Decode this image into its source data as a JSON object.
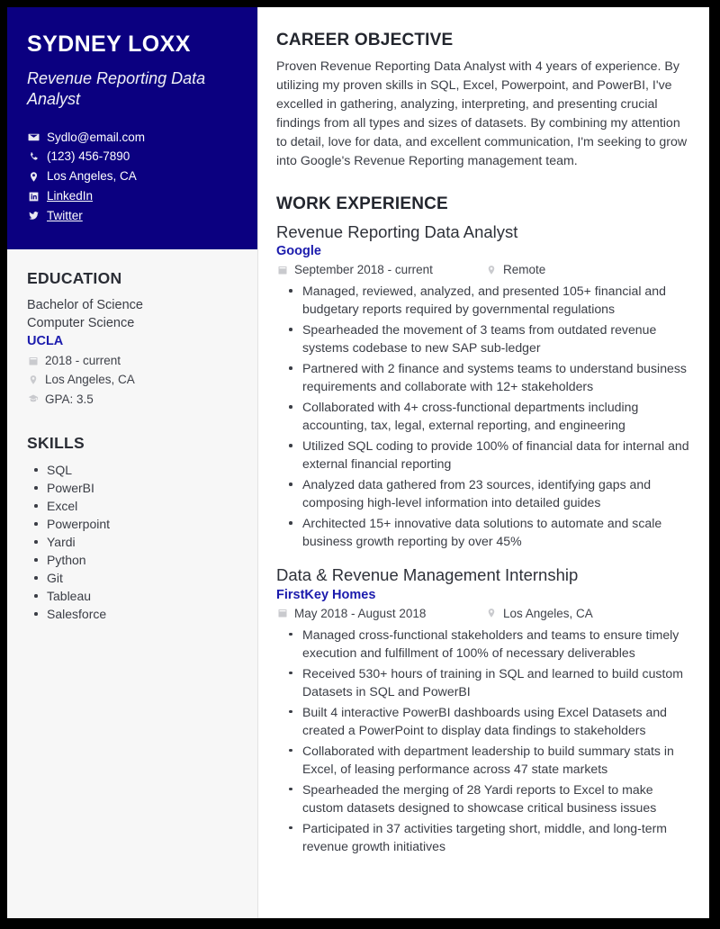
{
  "colors": {
    "sidebar_header_bg": "#0b0080",
    "accent_link": "#1b1bad",
    "sidebar_bg": "#f7f7f7",
    "page_border": "#000000",
    "body_text": "#3a3d45"
  },
  "sidebar": {
    "name": "SYDNEY LOXX",
    "title": "Revenue Reporting Data Analyst",
    "contacts": [
      {
        "icon": "envelope-icon",
        "text": "Sydlo@email.com",
        "is_link": false
      },
      {
        "icon": "phone-icon",
        "text": "(123) 456-7890",
        "is_link": false
      },
      {
        "icon": "location-pin-icon",
        "text": "Los Angeles, CA",
        "is_link": false
      },
      {
        "icon": "linkedin-icon",
        "text": "LinkedIn",
        "is_link": true
      },
      {
        "icon": "twitter-icon",
        "text": "Twitter",
        "is_link": true
      }
    ],
    "education": {
      "heading": "EDUCATION",
      "degree_line1": "Bachelor of Science",
      "degree_line2": "Computer Science",
      "school": "UCLA",
      "meta": [
        {
          "icon": "calendar-icon",
          "text": "2018 - current"
        },
        {
          "icon": "location-pin-icon",
          "text": "Los Angeles, CA"
        },
        {
          "icon": "graduation-cap-icon",
          "text": "GPA: 3.5"
        }
      ]
    },
    "skills": {
      "heading": "SKILLS",
      "items": [
        "SQL",
        "PowerBI",
        "Excel",
        "Powerpoint",
        "Yardi",
        "Python",
        "Git",
        "Tableau",
        "Salesforce"
      ]
    }
  },
  "main": {
    "objective": {
      "heading": "CAREER OBJECTIVE",
      "text": "Proven Revenue Reporting Data Analyst with 4 years of experience. By utilizing my proven skills in SQL, Excel, Powerpoint, and PowerBI, I've excelled in gathering, analyzing, interpreting, and presenting crucial findings from all types and sizes of datasets. By combining my attention to detail, love for data, and excellent communication, I'm seeking to grow into Google's Revenue Reporting management team."
    },
    "work": {
      "heading": "WORK EXPERIENCE",
      "jobs": [
        {
          "role": "Revenue Reporting Data Analyst",
          "company": "Google",
          "dates": "September 2018 - current",
          "location": "Remote",
          "bullets": [
            "Managed, reviewed, analyzed, and presented 105+ financial and budgetary reports required by governmental regulations",
            "Spearheaded the movement of 3 teams from outdated revenue systems codebase to new SAP sub-ledger",
            "Partnered with 2 finance and systems teams to understand business requirements and collaborate with 12+ stakeholders",
            "Collaborated with 4+ cross-functional departments including accounting, tax, legal, external reporting, and engineering",
            "Utilized SQL coding to provide 100% of financial data for internal and external financial reporting",
            "Analyzed data gathered from 23 sources, identifying gaps and composing high-level information into detailed guides",
            "Architected 15+ innovative data solutions to automate and scale business growth reporting by over 45%"
          ]
        },
        {
          "role": "Data & Revenue Management Internship",
          "company": "FirstKey Homes",
          "dates": "May 2018 - August 2018",
          "location": "Los Angeles, CA",
          "bullets": [
            "Managed cross-functional stakeholders and teams to ensure timely execution and fulfillment of 100% of necessary deliverables",
            "Received 530+ hours of training in SQL and learned to build custom Datasets in SQL and PowerBI",
            "Built 4 interactive PowerBI dashboards using Excel Datasets and created a PowerPoint to display data findings to stakeholders",
            "Collaborated with department leadership to build summary stats in Excel, of leasing performance across 47 state markets",
            "Spearheaded the merging of 28 Yardi reports to Excel to make custom datasets designed to showcase critical business issues",
            "Participated in 37 activities targeting short, middle, and long-term revenue growth initiatives"
          ]
        }
      ]
    }
  }
}
